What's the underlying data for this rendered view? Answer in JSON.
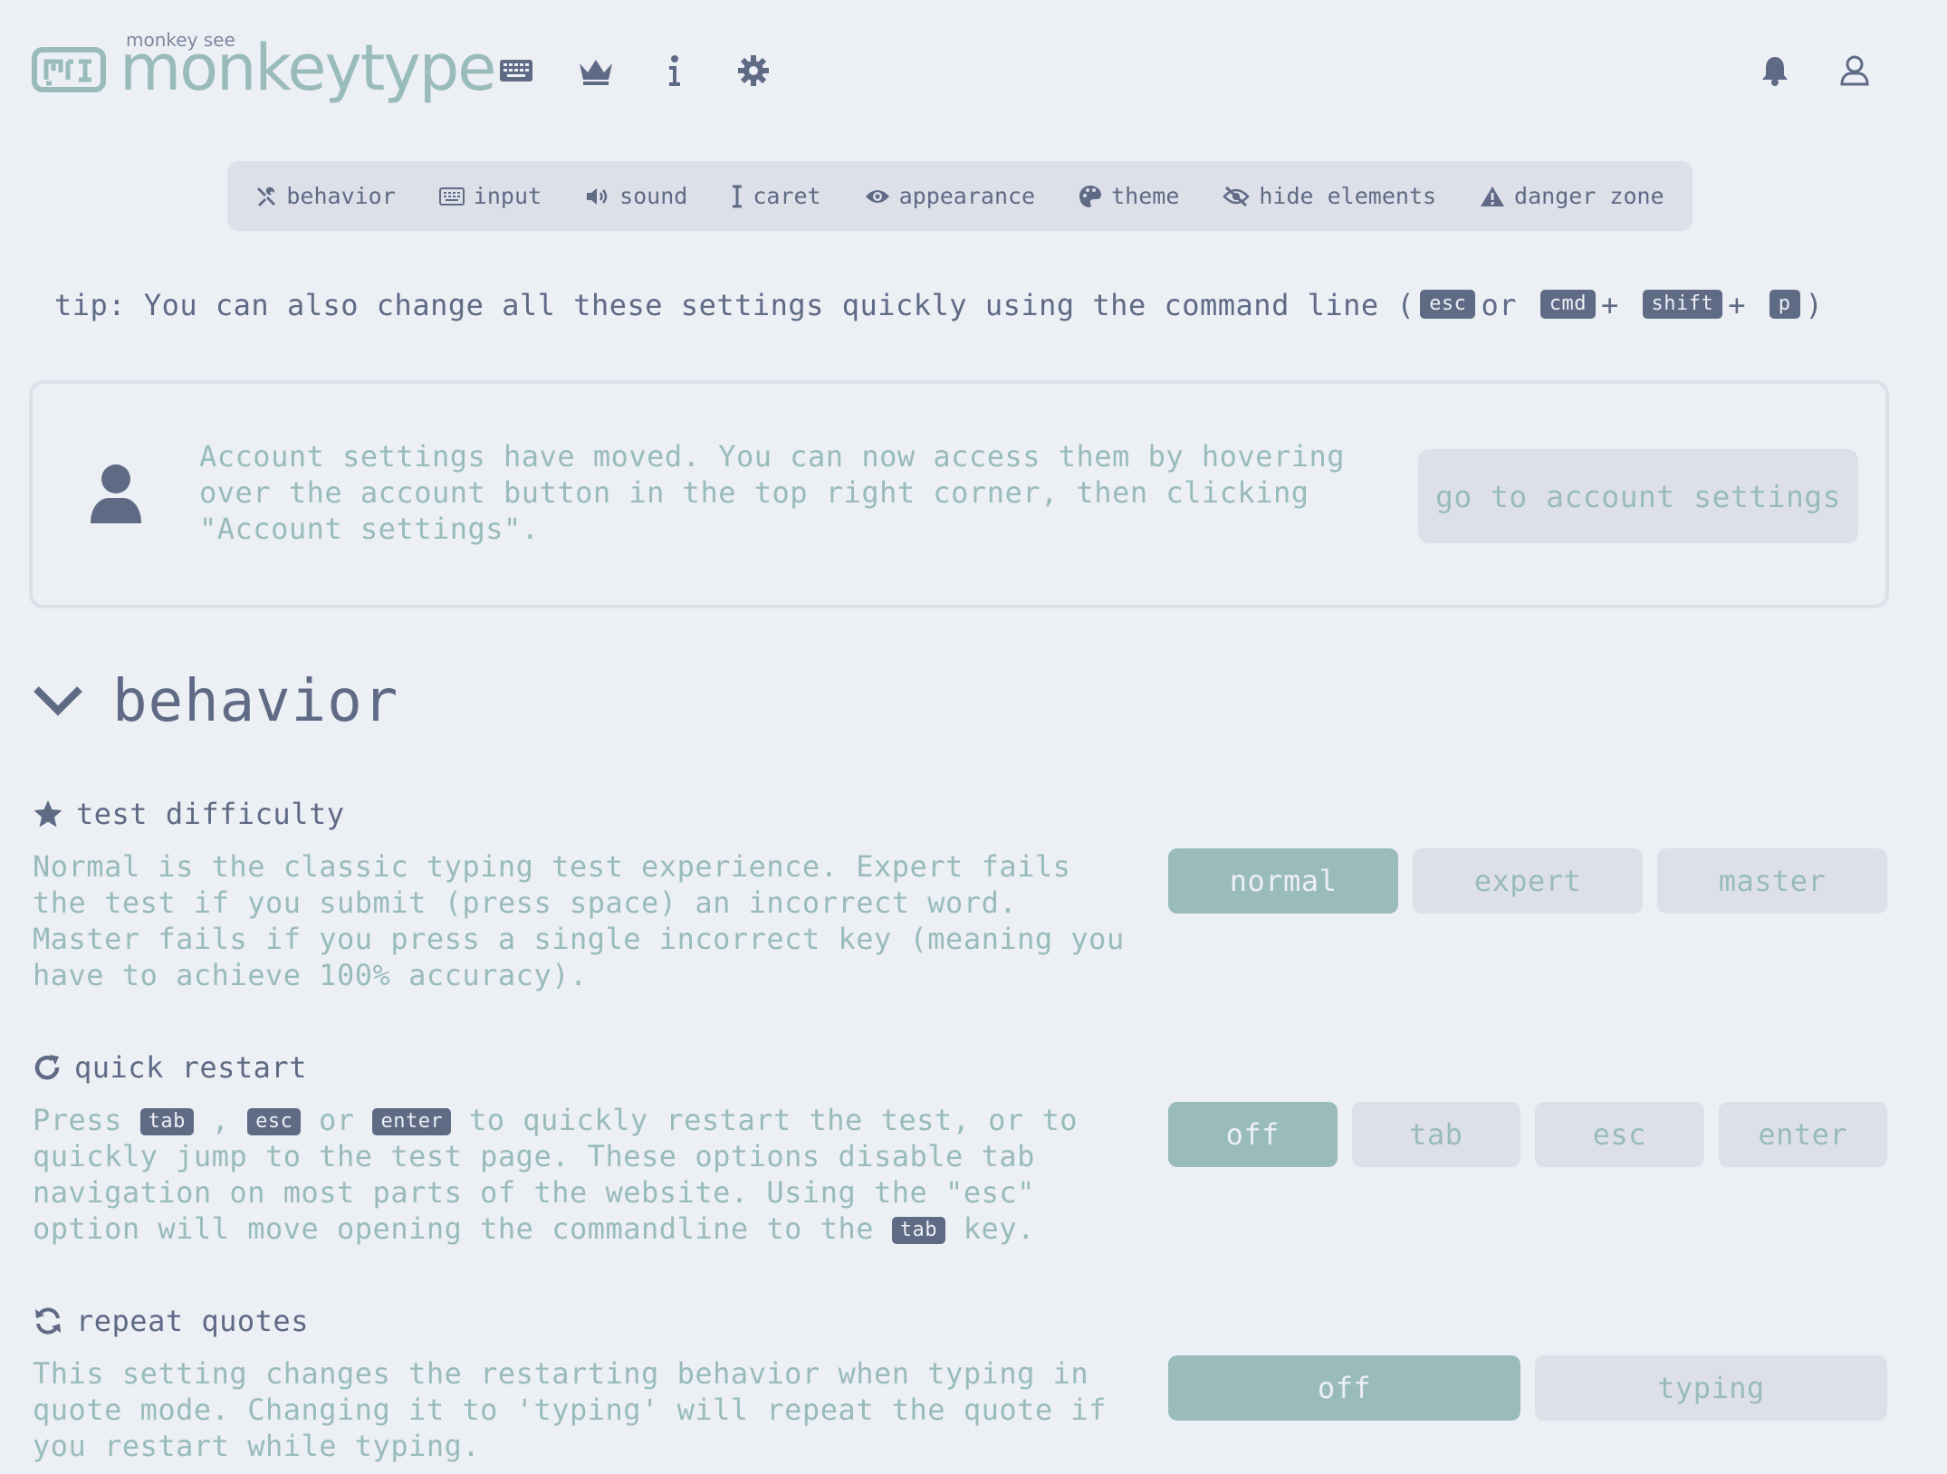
{
  "header": {
    "logo_top": "monkey see",
    "logo_text": "monkeytype",
    "nav_icons": [
      "keyboard-icon",
      "crown-icon",
      "info-icon",
      "gear-icon"
    ],
    "right_icons": [
      "bell-icon",
      "user-icon"
    ]
  },
  "tabs": [
    {
      "label": "behavior",
      "icon": "tools-icon"
    },
    {
      "label": "input",
      "icon": "keyboard-icon"
    },
    {
      "label": "sound",
      "icon": "volume-icon"
    },
    {
      "label": "caret",
      "icon": "i-cursor-icon"
    },
    {
      "label": "appearance",
      "icon": "eye-icon"
    },
    {
      "label": "theme",
      "icon": "palette-icon"
    },
    {
      "label": "hide elements",
      "icon": "eye-slash-icon"
    },
    {
      "label": "danger zone",
      "icon": "warning-icon"
    }
  ],
  "tip": {
    "prefix": "tip: You can also change all these settings quickly using the command line (",
    "key1": "esc",
    "or": "or",
    "key2": "cmd",
    "plus1": "+",
    "key3": "shift",
    "plus2": "+",
    "key4": "p",
    "suffix": ")"
  },
  "notice": {
    "text": "Account settings have moved. You can now access them by hovering over the account button in the top right corner, then clicking \"Account settings\".",
    "button": "go to account settings"
  },
  "section": {
    "title": "behavior"
  },
  "settings": {
    "difficulty": {
      "title": "test difficulty",
      "desc": "Normal is the classic typing test experience. Expert fails the test if you submit (press space) an incorrect word. Master fails if you press a single incorrect key (meaning you have to achieve 100% accuracy).",
      "options": [
        "normal",
        "expert",
        "master"
      ],
      "selected": "normal"
    },
    "quick_restart": {
      "title": "quick restart",
      "desc_1": "Press",
      "key_tab": "tab",
      "comma": ",",
      "key_esc": "esc",
      "or": "or",
      "key_enter": "enter",
      "desc_2": "to quickly restart the test, or to quickly jump to the test page. These options disable tab navigation on most parts of the website. Using the \"esc\" option will move opening the commandline to the",
      "key_tab2": "tab",
      "desc_3": "key.",
      "options": [
        "off",
        "tab",
        "esc",
        "enter"
      ],
      "selected": "off"
    },
    "repeat_quotes": {
      "title": "repeat quotes",
      "desc": "This setting changes the restarting behavior when typing in quote mode. Changing it to 'typing' will repeat the quote if you restart while typing.",
      "options": [
        "off",
        "typing"
      ],
      "selected": "off"
    }
  }
}
